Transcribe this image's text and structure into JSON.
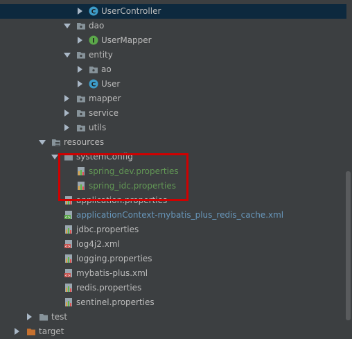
{
  "tree": {
    "items": [
      {
        "label": "UserController"
      },
      {
        "label": "dao"
      },
      {
        "label": "UserMapper"
      },
      {
        "label": "entity"
      },
      {
        "label": "ao"
      },
      {
        "label": "User"
      },
      {
        "label": "mapper"
      },
      {
        "label": "service"
      },
      {
        "label": "utils"
      },
      {
        "label": "resources"
      },
      {
        "label": "systemConfig"
      },
      {
        "label": "spring_dev.properties"
      },
      {
        "label": "spring_idc.properties"
      },
      {
        "label": "application.properties"
      },
      {
        "label": "applicationContext-mybatis_plus_redis_cache.xml"
      },
      {
        "label": "jdbc.properties"
      },
      {
        "label": "log4j2.xml"
      },
      {
        "label": "logging.properties"
      },
      {
        "label": "mybatis-plus.xml"
      },
      {
        "label": "redis.properties"
      },
      {
        "label": "sentinel.properties"
      },
      {
        "label": "test"
      },
      {
        "label": "target"
      }
    ]
  },
  "icons": {
    "class": "class-c-icon",
    "interface": "interface-i-icon",
    "folder": "folder-icon",
    "properties": "properties-file-icon",
    "xml": "xml-file-icon"
  },
  "colors": {
    "background": "#3c3f41",
    "selection": "#0d293e",
    "text": "#bbbbbb",
    "green_file": "#629755",
    "blue_file": "#6897bb",
    "highlight_box": "#d00000",
    "class_icon": "#3d9cc9",
    "interface_icon": "#5ba84a",
    "folder": "#87939a",
    "target_folder": "#c4702f"
  }
}
